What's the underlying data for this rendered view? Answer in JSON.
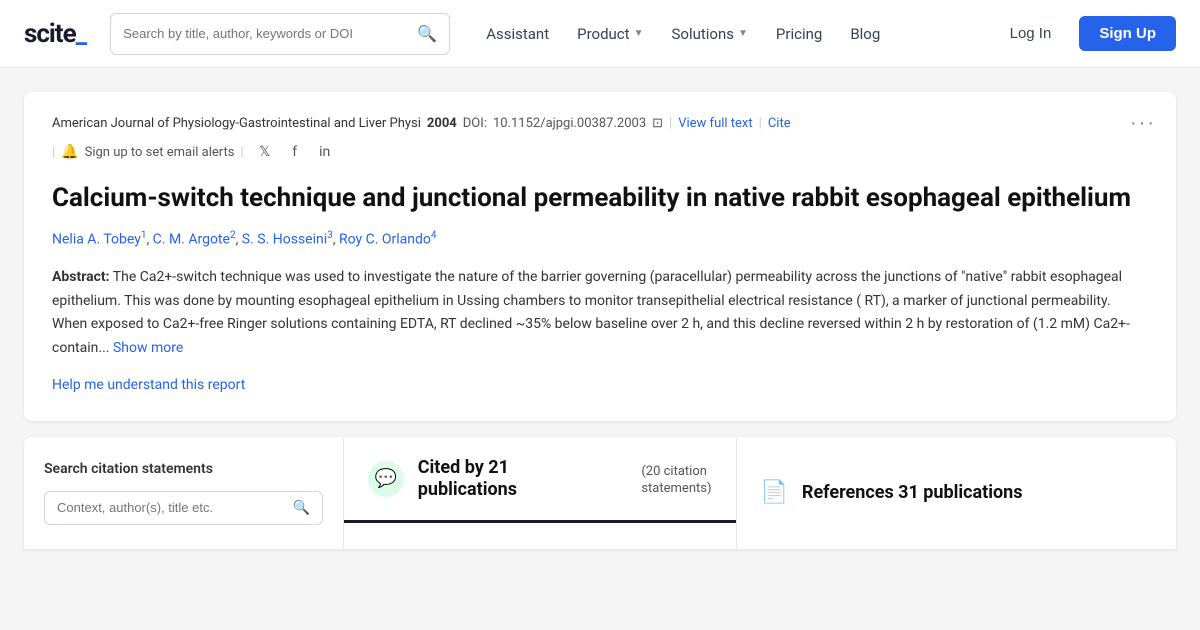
{
  "logo": {
    "text": "scite_"
  },
  "search": {
    "placeholder": "Search by title, author, keywords or DOI"
  },
  "nav": {
    "assistant": "Assistant",
    "product": "Product",
    "solutions": "Solutions",
    "pricing": "Pricing",
    "blog": "Blog",
    "login": "Log In",
    "signup": "Sign Up"
  },
  "article": {
    "journal": "American Journal of Physiology-Gastrointestinal and Liver Physi",
    "year": "2004",
    "doi_label": "DOI:",
    "doi": "10.1152/ajpgi.00387.2003",
    "view_full_text": "View full text",
    "cite": "Cite",
    "email_alert": "Sign up to set email alerts",
    "title": "Calcium-switch technique and junctional permeability in native rabbit esophageal epithelium",
    "authors": [
      {
        "name": "Nelia A. Tobey",
        "sup": "1"
      },
      {
        "name": "C. M. Argote",
        "sup": "2"
      },
      {
        "name": "S. S. Hosseini",
        "sup": "3"
      },
      {
        "name": "Roy C. Orlando",
        "sup": "4"
      }
    ],
    "abstract_label": "Abstract:",
    "abstract_text": "The Ca2+-switch technique was used to investigate the nature of the barrier governing (paracellular) permeability across the junctions of \"native\" rabbit esophageal epithelium. This was done by mounting esophageal epithelium in Ussing chambers to monitor transepithelial electrical resistance ( RT), a marker of junctional permeability. When exposed to Ca2+-free Ringer solutions containing EDTA, RT declined ~35% below baseline over 2 h, and this decline reversed within 2 h by restoration of (1.2 mM) Ca2+-contain...",
    "show_more": "Show more",
    "help_link": "Help me understand this report"
  },
  "bottom": {
    "search_panel_title": "Search citation statements",
    "search_panel_placeholder": "Context, author(s), title etc.",
    "cited_bubble_icon": "💬",
    "cited_main": "Cited by 21",
    "cited_sub_line1": "publications",
    "cited_statements": "(20 citation",
    "cited_statements2": "statements)",
    "references_icon": "📄",
    "references_text": "References 31 publications"
  }
}
